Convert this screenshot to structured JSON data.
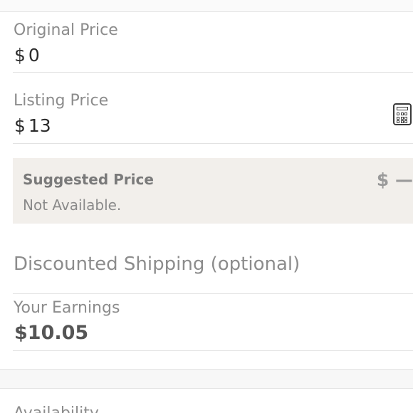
{
  "original_price": {
    "label": "Original Price",
    "currency": "$",
    "value": "0"
  },
  "listing_price": {
    "label": "Listing Price",
    "currency": "$",
    "value": "13",
    "calculator_icon": "calculator-icon"
  },
  "suggested_price": {
    "title": "Suggested Price",
    "status": "Not Available.",
    "value": "$ —"
  },
  "discounted_shipping": {
    "label": "Discounted Shipping (optional)"
  },
  "earnings": {
    "label": "Your Earnings",
    "value": "$10.05"
  },
  "next_section": {
    "label": "Availability"
  },
  "colors": {
    "suggested_bg": "#f2efeb",
    "label_grey": "#8c8c8c",
    "value_dark": "#2b2b2b"
  }
}
